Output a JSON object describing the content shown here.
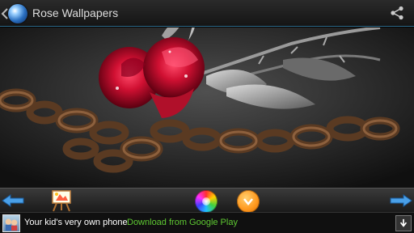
{
  "header": {
    "title": "Rose Wallpapers",
    "app_icon": "globe-icon",
    "back_icon": "chevron-left-icon",
    "share_icon": "share-icon"
  },
  "photo": {
    "subject": "red-rose-on-rusty-chain"
  },
  "toolbar": {
    "previous_icon": "arrow-left-icon",
    "set_wallpaper_icon": "easel-icon",
    "color_icon": "color-wheel-icon",
    "download_icon": "download-icon",
    "next_icon": "arrow-right-icon",
    "accent": "#3b8fd8"
  },
  "ad": {
    "text": "Your kid's very own phone",
    "link_text": "Download from Google Play",
    "link_color": "#5ec832",
    "close_icon": "download-arrow-icon"
  }
}
